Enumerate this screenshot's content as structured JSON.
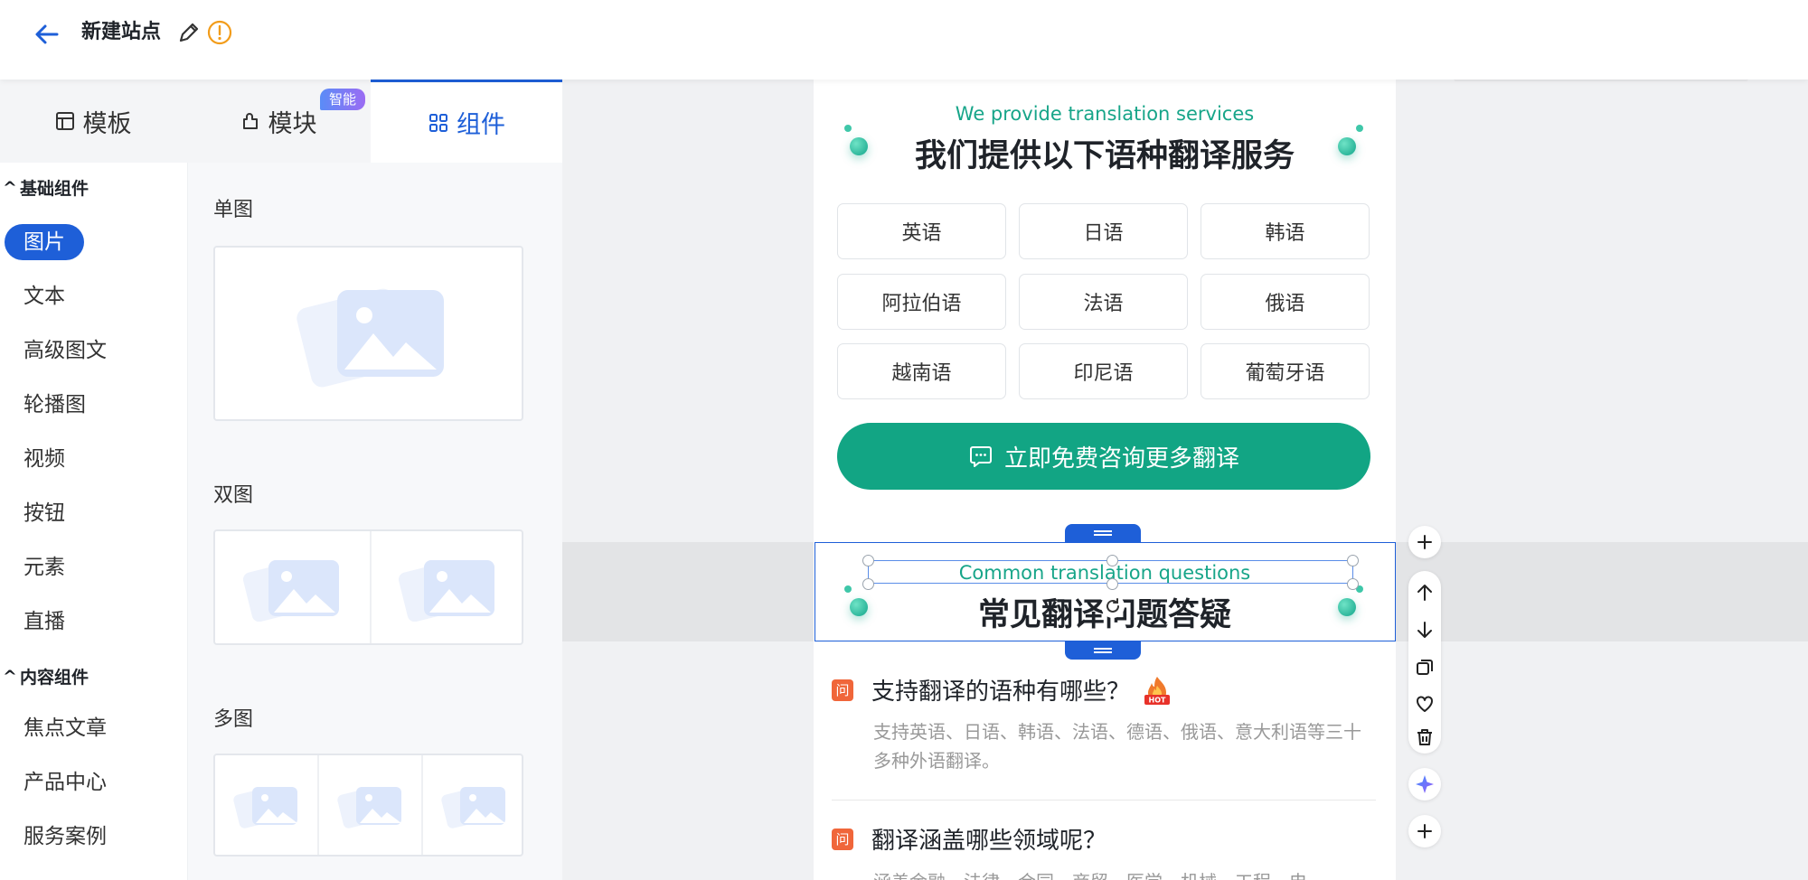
{
  "header": {
    "title": "新建站点"
  },
  "tabs": [
    {
      "label": "模板",
      "icon": "layout-icon"
    },
    {
      "label": "模块",
      "icon": "puzzle-icon"
    },
    {
      "label": "组件",
      "icon": "grid-icon"
    }
  ],
  "smart_badge": "智能",
  "categories": {
    "group1": "基础组件",
    "basic": [
      "图片",
      "文本",
      "高级图文",
      "轮播图",
      "视频",
      "按钮",
      "元素",
      "直播"
    ],
    "group2": "内容组件",
    "content": [
      "焦点文章",
      "产品中心",
      "服务案例"
    ]
  },
  "components": {
    "single": "单图",
    "double": "双图",
    "multi": "多图"
  },
  "page": {
    "section1_sub": "We provide translation services",
    "section1_title": "我们提供以下语种翻译服务",
    "languages": [
      "英语",
      "日语",
      "韩语",
      "阿拉伯语",
      "法语",
      "俄语",
      "越南语",
      "印尼语",
      "葡萄牙语"
    ],
    "cta": "立即免费咨询更多翻译",
    "section2_sub": "Common translation questions",
    "section2_title": "常见翻译问题答疑",
    "faq": [
      {
        "badge": "问",
        "q": "支持翻译的语种有哪些？",
        "a": "支持英语、日语、韩语、法语、德语、俄语、意大利语等三十多种外语翻译。"
      },
      {
        "badge": "问",
        "q": "翻译涵盖哪些领域呢？",
        "a": "涵盖金融、法律、合同、商贸、医学、机械、工程、电"
      }
    ],
    "hot": "HOT"
  },
  "colors": {
    "primary": "#1e5fd8",
    "teal": "#12a584",
    "orange": "#f0663a"
  }
}
